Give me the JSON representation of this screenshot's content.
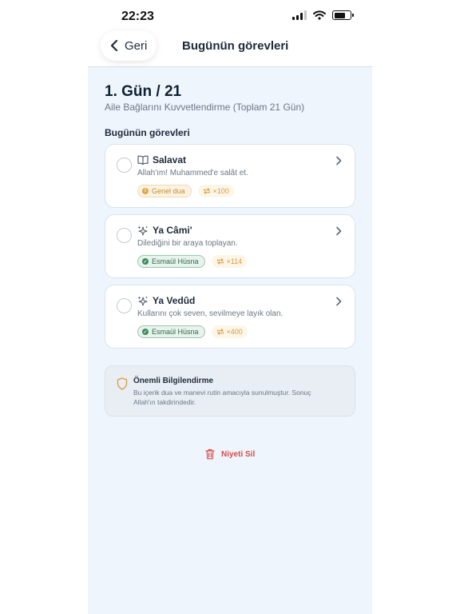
{
  "status_bar": {
    "time": "22:23"
  },
  "header": {
    "back_label": "Geri",
    "title": "Bugünün görevleri"
  },
  "day": {
    "title": "1. Gün / 21",
    "subtitle": "Aile Bağlarını Kuvvetlendirme (Toplam 21 Gün)"
  },
  "section_title": "Bugünün görevleri",
  "tasks": [
    {
      "icon": "book-icon",
      "title": "Salavat",
      "description": "Allah'ım! Muhammed'e salât et.",
      "tag": "Genel dua",
      "count": "×100",
      "completed": false
    },
    {
      "icon": "sparkles-icon",
      "title": "Ya Câmi'",
      "description": "Dilediğini bir araya toplayan.",
      "tag": "Esmaül Hüsna",
      "count": "×114",
      "completed": false
    },
    {
      "icon": "sparkles-icon",
      "title": "Ya Vedûd",
      "description": "Kullarını çok seven, sevilmeye layık olan.",
      "tag": "Esmaül Hüsna",
      "count": "×400",
      "completed": false
    }
  ],
  "notice": {
    "title": "Önemli Bilgilendirme",
    "text": "Bu içerik dua ve manevi rutin amacıyla sunulmuştur. Sonuç Allah'ın takdirindedir."
  },
  "delete_label": "Niyeti Sil",
  "colors": {
    "background": "#eef5fd",
    "accent_gold": "#d99a3a",
    "accent_green": "#3a8a5d",
    "danger": "#d94c47"
  }
}
